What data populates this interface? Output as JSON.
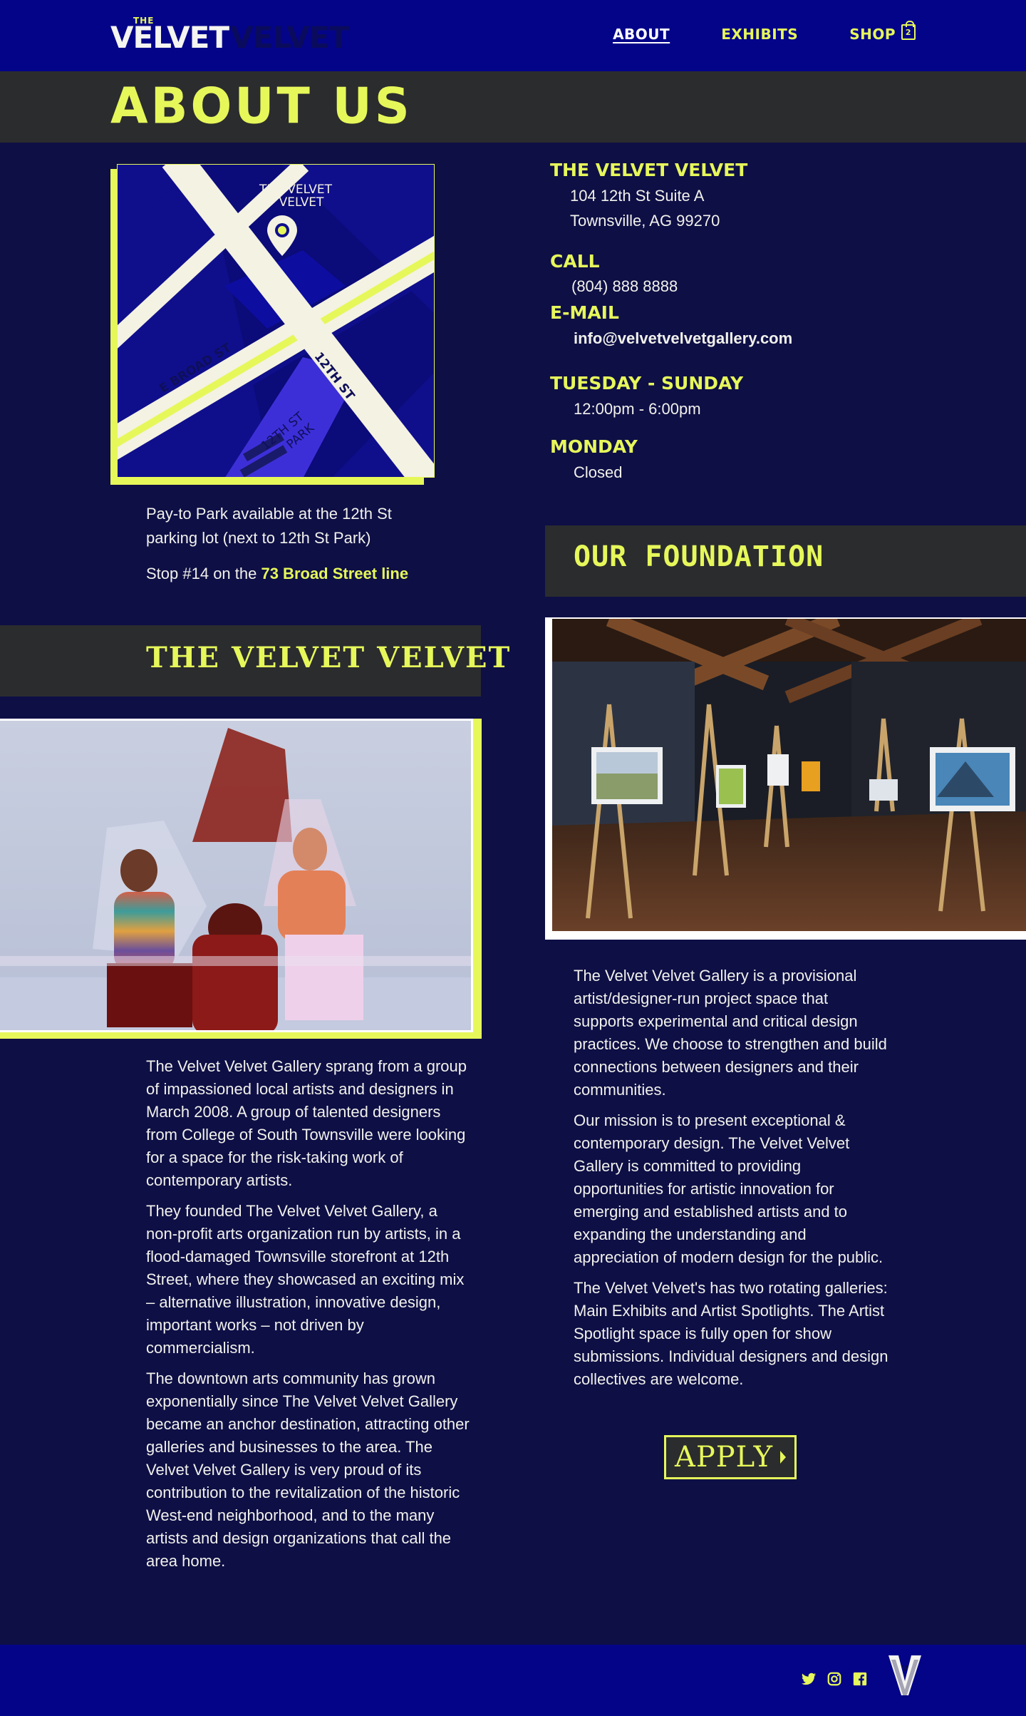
{
  "header": {
    "logo_the": "THE",
    "logo_word": "VELVET",
    "logo_word_shadow": "VELVET",
    "nav": [
      {
        "label": "ABOUT",
        "active": true
      },
      {
        "label": "EXHIBITS",
        "active": false
      },
      {
        "label": "SHOP",
        "active": false
      }
    ],
    "cart_count": "2",
    "cart_icon": "shopping-bag-icon"
  },
  "page_title": "ABOUT US",
  "map": {
    "pin_label_line1": "THE VELVET",
    "pin_label_line2": "VELVET",
    "street_broad": "E BROAD ST",
    "street_12th": "12TH ST",
    "park_line1": "12TH ST",
    "park_line2": "PARK"
  },
  "parking": {
    "line1": "Pay-to Park available at the 12th St",
    "line2": "parking lot (next to 12th St Park)",
    "stop_prefix": "Stop #14 on the ",
    "stop_link": "73 Broad Street line"
  },
  "contact": {
    "name_label": "THE VELVET VELVET",
    "address_line1": "104 12th St Suite A",
    "address_line2": "Townsville, AG 99270",
    "call_label": "CALL",
    "phone": "(804) 888 8888",
    "email_label": "E-MAIL",
    "email": "info@velvetvelvetgallery.com",
    "hours1_label": "TUESDAY - SUNDAY",
    "hours1": "12:00pm - 6:00pm",
    "hours2_label": "MONDAY",
    "hours2": "Closed"
  },
  "left_section": {
    "title": "THE VELVET VELVET",
    "paragraphs": [
      "The Velvet Velvet Gallery sprang from a group of impassioned local artists and designers in March 2008. A group of talented designers from College of South Townsville were looking for a space for the risk-taking work of contemporary artists.",
      "They founded The Velvet Velvet Gallery, a non-profit arts organization run by artists, in a flood-damaged Townsville storefront at 12th Street, where they showcased an exciting mix – alternative illustration, innovative design, important works – not driven by commercialism.",
      "The downtown arts community has grown exponentially since  The Velvet Velvet Gallery became an anchor destination, attracting other galleries and businesses to the area. The Velvet Velvet Gallery is very proud of its contribution to the revitalization of the historic West-end neighborhood, and to the many artists and design organizations that call the area home."
    ]
  },
  "right_section": {
    "title": "OUR FOUNDATION",
    "paragraphs": [
      "The Velvet Velvet Gallery is a provisional artist/designer-run project space that supports experimental and critical design practices. We choose to strengthen and build connections between designers and their communities.",
      "Our mission is to present exceptional & contemporary design. The Velvet Velvet Gallery is committed to providing opportunities for artistic innovation for emerging and established artists and to expanding the understanding and appreciation of modern design for the public.",
      "The Velvet Velvet's has two rotating galleries: Main Exhibits and Artist Spotlights. The Artist Spotlight space is fully open for show submissions. Individual designers and design collectives are welcome."
    ],
    "apply_label": "APPLY"
  },
  "footer": {
    "icons": [
      "twitter-icon",
      "instagram-icon",
      "facebook-icon"
    ],
    "logo_letter": "V"
  },
  "colors": {
    "nav_bg": "#040489",
    "page_bg": "#0e0f45",
    "accent": "#e6f75a",
    "band_bg": "#2b2c2e"
  }
}
